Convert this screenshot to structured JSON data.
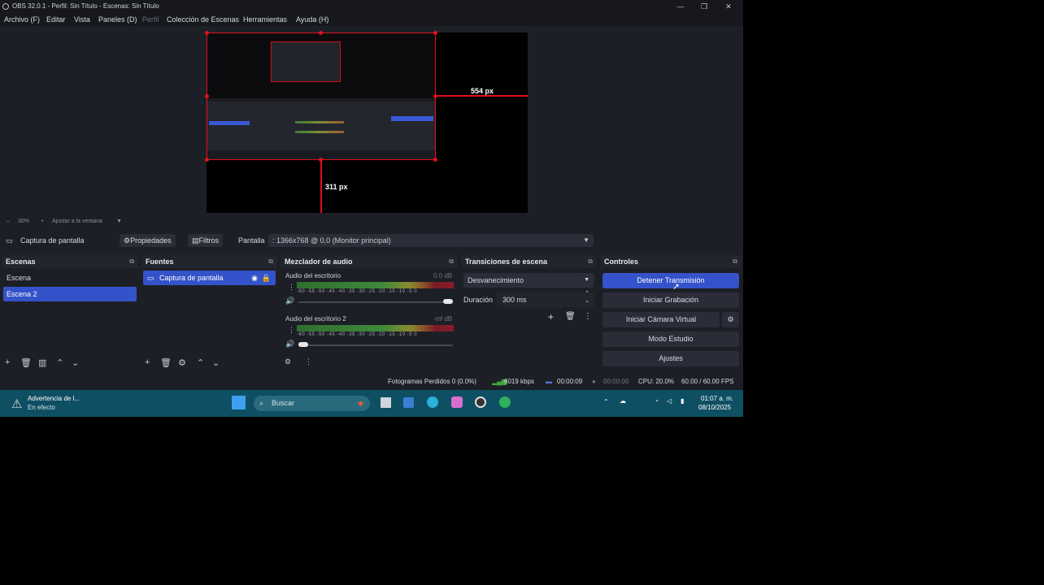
{
  "window": {
    "title": "OBS 32.0.1 - Perfil: Sin Título - Escenas: Sin Título",
    "minimize": "—",
    "maximize": "❐",
    "close": "✕"
  },
  "menu": {
    "items": [
      "Archivo (F)",
      "Editar",
      "Vista",
      "Paneles (D)",
      "Perfil",
      "Colección de Escenas",
      "Herramientas",
      "Ayuda (H)"
    ]
  },
  "preview": {
    "width_label": "554 px",
    "height_label": "311 px",
    "zoom": "30%",
    "fit_label": "Ajustar a la ventana"
  },
  "source_bar": {
    "source_name": "Captura de pantalla",
    "properties": "Propiedades",
    "filters": "Filtros",
    "screen_label": "Pantalla",
    "screen_value": ": 1366x768 @ 0,0 (Monitor principal)"
  },
  "scenes": {
    "header": "Escenas",
    "items": [
      "Escena",
      "Escena 2"
    ],
    "selected": "Escena 2"
  },
  "sources": {
    "header": "Fuentes",
    "items": [
      "Captura de pantalla"
    ]
  },
  "mixer": {
    "header": "Mezclador de audio",
    "channels": [
      {
        "name": "Audio del escritorio",
        "db": "0.0 dB"
      },
      {
        "name": "Audio del escritorio 2",
        "db": "-inf dB"
      }
    ],
    "ticks": "-60 -55 -50 -45 -40 -35 -30 -25 -20 -15 -10 -5 0"
  },
  "transitions": {
    "header": "Transiciones de escena",
    "selected": "Desvanecimiento",
    "duration_label": "Duración",
    "duration_value": "300 ms"
  },
  "controls": {
    "header": "Controles",
    "stop_stream": "Detener Transmisión",
    "start_recording": "Iniciar Grabación",
    "start_virtual_cam": "Iniciar Cámara Virtual",
    "studio_mode": "Modo Estudio",
    "settings": "Ajustes"
  },
  "status": {
    "dropped_frames": "Fotogramas Perdidos 0 (0.0%)",
    "bitrate": "6019 kbps",
    "stream_time": "00:00:09",
    "record_time": "00:00:00",
    "cpu": "CPU: 20.0%",
    "fps": "60.00 / 60.00 FPS"
  },
  "taskbar": {
    "weather_title": "Advertencia de l...",
    "weather_sub": "En efecto",
    "search": "Buscar",
    "time": "01:07 a. m.",
    "date": "08/10/2025"
  },
  "colors": {
    "accent": "#3452c9",
    "guide_red": "#e0101a",
    "taskbar": "#0f4f63"
  }
}
